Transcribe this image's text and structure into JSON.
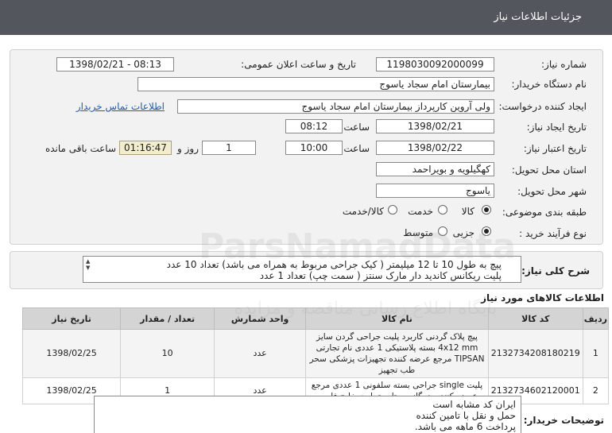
{
  "header": {
    "title": "جزئیات اطلاعات نیاز"
  },
  "form": {
    "need_number": {
      "label": "شماره نیاز:",
      "value": "1198030092000099"
    },
    "announce": {
      "label": "تاریخ و ساعت اعلان عمومی:",
      "value": "1398/02/21 - 08:13"
    },
    "buyer_org": {
      "label": "نام دستگاه خریدار:",
      "value": "بیمارستان امام سجاد یاسوج"
    },
    "requester": {
      "label": "ایجاد کننده درخواست:",
      "value": "ولی آروین کارپرداز بیمارستان امام سجاد یاسوج"
    },
    "contact_link": "اطلاعات تماس خریدار",
    "created": {
      "label": "تاریخ ایجاد نیاز:",
      "date": "1398/02/21",
      "time_label": "ساعت",
      "time": "08:12"
    },
    "validity": {
      "label": "تاریخ اعتبار نیاز:",
      "date": "1398/02/22",
      "time_label": "ساعت",
      "time": "10:00",
      "days": "1",
      "days_label": "روز و",
      "remaining": "01:16:47",
      "remaining_label": "ساعت باقی مانده"
    },
    "province": {
      "label": "استان محل تحویل:",
      "value": "کهگیلویه و بویراحمد"
    },
    "city": {
      "label": "شهر محل تحویل:",
      "value": "یاسوج"
    },
    "category": {
      "label": "طبقه بندی موضوعی:",
      "options": [
        "کالا",
        "خدمت",
        "کالا/خدمت"
      ],
      "selected": "کالا"
    },
    "process": {
      "label": "نوع فرآیند خرید :",
      "options": [
        "جزیی",
        "متوسط"
      ],
      "selected": "جزیی"
    }
  },
  "description": {
    "label": "شرح کلی نیاز:",
    "lines": [
      "پیچ به طول 10 تا 12 میلیمتر ( کیک جراحی مربوط به همراه می باشد) تعداد 10 عدد",
      "پلیت ریکانس کاندید دار مارک سنتز ( سمت چپ) تعداد 1 عدد"
    ]
  },
  "goods": {
    "title": "اطلاعات کالاهای مورد نیاز",
    "columns": [
      "ردیف",
      "کد کالا",
      "نام کالا",
      "واحد شمارش",
      "تعداد / مقدار",
      "تاریخ نیاز"
    ],
    "rows": [
      {
        "index": "1",
        "code": "2132734208180219",
        "name": "پیچ پلاک گردنی کاربرد پلیت جراحی گردن سایز 4x12 mm بسته پلاستیکی 1 عددی نام تجارتی TIPSAN مرجع عرضه کننده تجهیزات پزشکی سحر طب تجهیز",
        "unit": "عدد",
        "qty": "10",
        "date": "1398/02/25"
      },
      {
        "index": "2",
        "code": "2132734602120001",
        "name": "پلیت single جراحی بسته سلفونی 1 عددی مرجع عرضه کننده بزرگانی ستاره تجارت خلیج فارس",
        "unit": "عدد",
        "qty": "1",
        "date": "1398/02/25"
      }
    ]
  },
  "buyer_notes": {
    "label": "توضیحات خریدار:",
    "lines": [
      "ایران کد مشابه است",
      "حمل و نقل با تامین کننده",
      "پرداخت 6 ماهه می باشد."
    ]
  },
  "watermark": {
    "text": "ParsNamadData",
    "subtext": "پایگاه اطلاع رسانی مناقصه و مزایده"
  }
}
